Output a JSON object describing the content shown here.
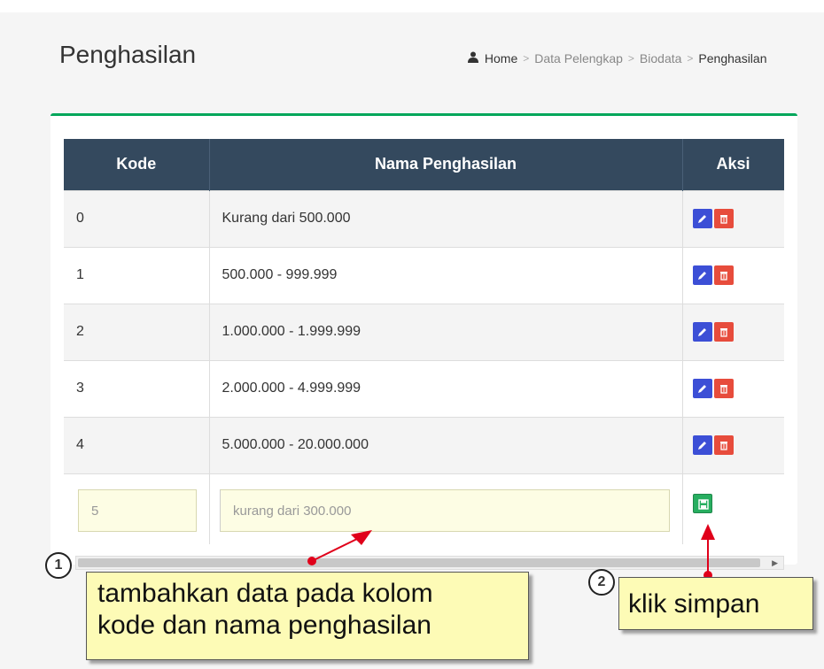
{
  "page": {
    "title": "Penghasilan"
  },
  "breadcrumb": {
    "home": "Home",
    "sep": ">",
    "items": [
      "Data Pelengkap",
      "Biodata",
      "Penghasilan"
    ]
  },
  "table": {
    "headers": [
      "Kode",
      "Nama Penghasilan",
      "Aksi"
    ],
    "rows": [
      {
        "kode": "0",
        "nama": "Kurang dari 500.000"
      },
      {
        "kode": "1",
        "nama": "500.000 - 999.999"
      },
      {
        "kode": "2",
        "nama": "1.000.000 - 1.999.999"
      },
      {
        "kode": "3",
        "nama": "2.000.000 - 4.999.999"
      },
      {
        "kode": "4",
        "nama": "5.000.000 - 20.000.000"
      }
    ],
    "input": {
      "kode_value": "5",
      "nama_value": "kurang dari 300.000"
    }
  },
  "annotations": {
    "one": {
      "number": "1",
      "line1": "tambahkan data pada kolom",
      "line2": "kode dan nama penghasilan"
    },
    "two": {
      "number": "2",
      "text": "klik simpan"
    }
  },
  "icons": {
    "breadcrumb": "user-icon",
    "edit": "pencil-icon",
    "delete": "trash-icon",
    "save": "floppy-disk-icon"
  },
  "colors": {
    "header_bg": "#34495e",
    "box_accent": "#00a65a",
    "edit_button": "#3c4fd6",
    "delete_button": "#e74c3c",
    "save_button": "#27ae60",
    "callout_bg": "#fdfbb6",
    "annotation_red": "#e0001a"
  }
}
